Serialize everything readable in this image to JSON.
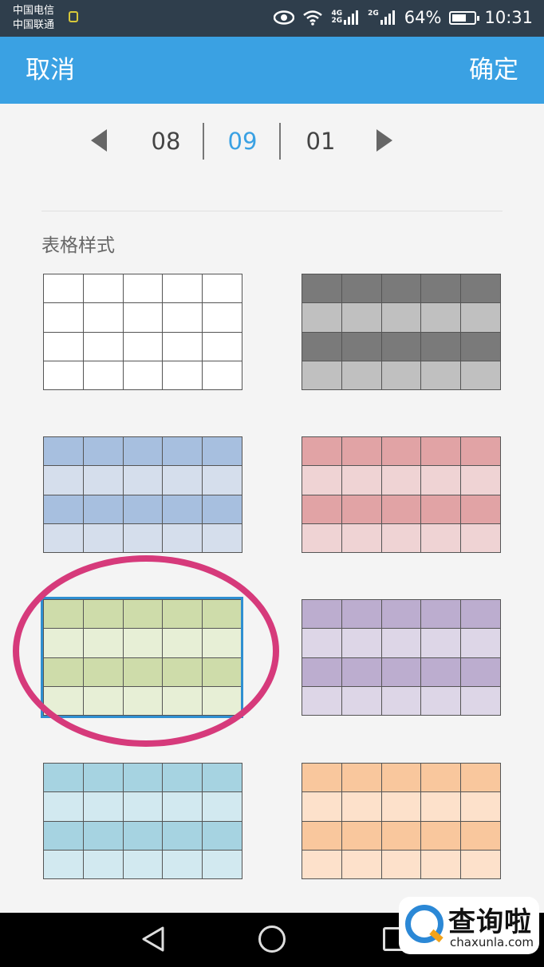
{
  "status_bar": {
    "carrier_1": "中国电信",
    "carrier_2": "中国联通",
    "net_tag_1a": "4G",
    "net_tag_1b": "2G",
    "net_tag_2": "2G",
    "battery_percent": "64%",
    "battery_level": 0.64,
    "time": "10:31"
  },
  "app_bar": {
    "cancel_label": "取消",
    "confirm_label": "确定",
    "color": "#3aa1e3"
  },
  "pager": {
    "pages": [
      "08",
      "09",
      "01"
    ],
    "current": "09"
  },
  "section": {
    "title": "表格样式"
  },
  "table_styles": [
    {
      "style": "plain-white",
      "header_color": "#ffffff",
      "band_color": "#ffffff"
    },
    {
      "style": "gray",
      "header_color": "#7a7a7a",
      "band_color": "#c0c0c0"
    },
    {
      "style": "blue",
      "header_color": "#a7bfdf",
      "band_color": "#d5deec"
    },
    {
      "style": "red",
      "header_color": "#e1a3a5",
      "band_color": "#efd3d4"
    },
    {
      "style": "green",
      "header_color": "#cedcaa",
      "band_color": "#e7efd6",
      "selected": true
    },
    {
      "style": "purple",
      "header_color": "#bcadcf",
      "band_color": "#ddd6e7"
    },
    {
      "style": "cyan",
      "header_color": "#a6d3e1",
      "band_color": "#d2e9f0"
    },
    {
      "style": "orange",
      "header_color": "#f9c79d",
      "band_color": "#fde1cb"
    }
  ],
  "highlight_color": "#d63a7b",
  "watermark": {
    "text": "查询啦",
    "url": "chaxunla.com"
  }
}
